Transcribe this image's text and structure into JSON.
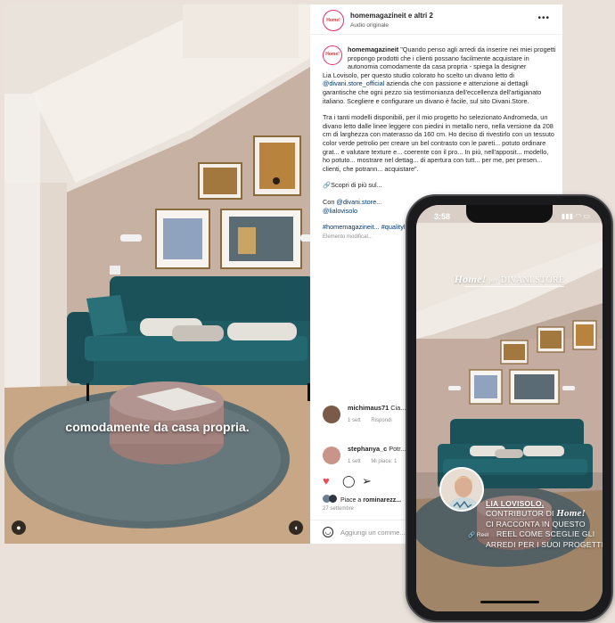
{
  "post": {
    "video_subtitle": "comodamente da casa propria.",
    "header": {
      "username": "homemagazineit e altri 2",
      "audio": "Audio originale",
      "avatar_text": "Home!"
    },
    "caption": {
      "username": "homemagazineit",
      "intro": "\"Quando penso agli arredi da inserire nei miei progetti propongo prodotti che i clienti possano facilmente acquistare in autonomia comodamente da casa propria - spiega la designer",
      "designer_prefix": "Lia Lovisolo, per questo studio colorato ho scelto un divano letto di",
      "mention_store": "@divani.store_official",
      "designer_rest": "azienda che con passione e attenzione ai dettagli garantische che ogni pezzo sia testimonianza dell'eccellenza dell'artigianato italiano. Scegliere e configurare un divano è facile, sul sito Divani.Store.",
      "paragraph2": "Tra i tanti modelli disponibili, per il mio progetto ho selezionato Andromeda, un divano letto dalle linee leggere con piedini in metallo nero, nella versione da 208 cm di larghezza con materasso da 160 cm. Ho deciso di rivestirlo con un tessuto color verde petrolio per creare un bel contrasto con le pareti... potuto ordinare grat... e valutare texture e... coerente con il pro... In più, nell'apposit... modello, ho potuto... mostrare nel dettag... di apertura con tutt... per me, per presen... clienti, che potrann... acquistare\".",
      "discover": "🔗Scopri di più sul...",
      "with_prefix": "Con",
      "with_mention1": "@divani.store...",
      "with_mention2": "@lialovisolo",
      "hashtags": "#homemagazineit... #qualityliving #div... #madeinitaly #pub...",
      "edited": "Elemento modificat..."
    },
    "comments": [
      {
        "username": "michimaus71",
        "text": "Cia... divano? Grazie",
        "age": "1 sett",
        "reply": "Rispondi",
        "likes": ""
      },
      {
        "username": "stephanya_c",
        "text": "Potr...",
        "age": "1 sett",
        "reply": "",
        "likes": "Mi piace: 1"
      }
    ],
    "likes_text": "Piace a",
    "likes_user": "rominarezz...",
    "date": "27 settembre",
    "add_comment_placeholder": "Aggiungi un comme..."
  },
  "phone": {
    "time": "3:58",
    "status_icons": "▮▮▮ ◠ ▭",
    "brand_home": "Home!",
    "brand_per": "per",
    "brand_store": "DIVANI.STORE",
    "reel_label": "🔗 Reel",
    "overlay": {
      "name": "LIA LOVISOLO,",
      "line2_prefix": "CONTRIBUTOR DI",
      "line2_brand": "Home!",
      "line3": "CI RACCONTA IN QUESTO",
      "line4": "REEL COME SCEGLIE GLI",
      "line5": "ARREDI PER I SUOI PROGETTI"
    }
  },
  "colors": {
    "background": "#e9e1da",
    "sofa": "#1f5a62",
    "wall": "#c9b3a6",
    "rug": "#5d6d72"
  }
}
